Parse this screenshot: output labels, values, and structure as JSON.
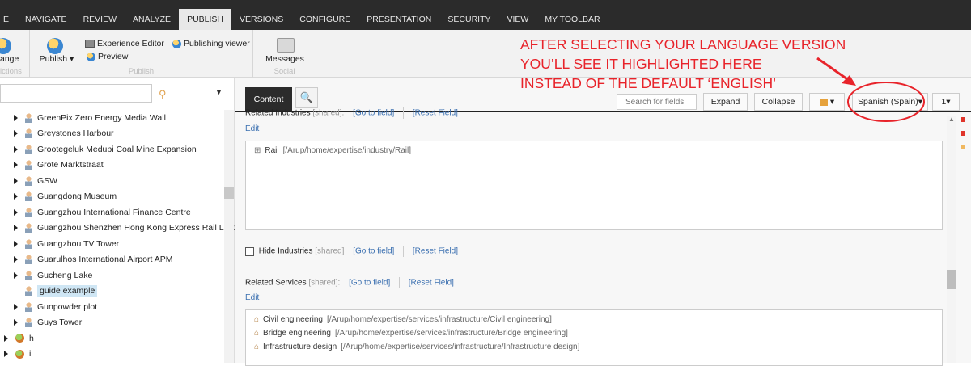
{
  "nav": {
    "tabs": [
      {
        "label": "E"
      },
      {
        "label": "NAVIGATE"
      },
      {
        "label": "REVIEW"
      },
      {
        "label": "ANALYZE"
      },
      {
        "label": "PUBLISH"
      },
      {
        "label": "VERSIONS"
      },
      {
        "label": "CONFIGURE"
      },
      {
        "label": "PRESENTATION"
      },
      {
        "label": "SECURITY"
      },
      {
        "label": "VIEW"
      },
      {
        "label": "MY TOOLBAR"
      }
    ],
    "active": "PUBLISH"
  },
  "ribbon": {
    "change_label": "ange",
    "restrictions_label": "ictions",
    "publish_label": "Publish",
    "experience_editor": "Experience Editor",
    "preview": "Preview",
    "publishing_viewer": "Publishing viewer",
    "publish_group_label": "Publish",
    "messages_label": "Messages",
    "social_group_label": "Social"
  },
  "tree": {
    "items": [
      {
        "label": "GreenPix Zero Energy Media Wall",
        "icon": "person-icon",
        "arrow": true
      },
      {
        "label": "Greystones Harbour",
        "icon": "person-icon",
        "arrow": true
      },
      {
        "label": "Grootegeluk Medupi Coal Mine Expansion",
        "icon": "person-icon",
        "arrow": true
      },
      {
        "label": "Grote Marktstraat",
        "icon": "person-icon",
        "arrow": true
      },
      {
        "label": "GSW",
        "icon": "person-icon",
        "arrow": true
      },
      {
        "label": "Guangdong Museum",
        "icon": "person-icon",
        "arrow": true
      },
      {
        "label": "Guangzhou International Finance Centre",
        "icon": "person-icon",
        "arrow": true
      },
      {
        "label": "Guangzhou Shenzhen Hong Kong Express Rail Link",
        "icon": "person-icon",
        "arrow": true
      },
      {
        "label": "Guangzhou TV Tower",
        "icon": "person-icon",
        "arrow": true
      },
      {
        "label": "Guarulhos International Airport APM",
        "icon": "person-icon",
        "arrow": true
      },
      {
        "label": "Gucheng Lake",
        "icon": "person-icon",
        "arrow": true
      },
      {
        "label": "guide example",
        "icon": "person-icon",
        "arrow": false,
        "selected": true
      },
      {
        "label": "Gunpowder plot",
        "icon": "person-icon",
        "arrow": true
      },
      {
        "label": "Guys Tower",
        "icon": "person-icon",
        "arrow": true
      },
      {
        "label": "h",
        "icon": "leaf-icon",
        "arrow": true
      },
      {
        "label": "i",
        "icon": "leaf-icon",
        "arrow": true
      }
    ]
  },
  "content": {
    "tab_label": "Content",
    "search_placeholder": "Search for fields",
    "expand": "Expand",
    "collapse": "Collapse",
    "language": "Spanish (Spain)",
    "version": "1",
    "industries": {
      "label": "Related Industries",
      "shared": "[shared]:",
      "goto": "[Go to field]",
      "reset": "[Reset Field]",
      "edit": "Edit",
      "items": [
        {
          "name": "Rail",
          "path": "[/Arup/home/expertise/industry/Rail]"
        }
      ]
    },
    "hide_industries": {
      "label": "Hide Industries",
      "shared": "[shared]",
      "goto": "[Go to field]",
      "reset": "[Reset Field]"
    },
    "services": {
      "label": "Related Services",
      "shared": "[shared]:",
      "goto": "[Go to field]",
      "reset": "[Reset Field]",
      "edit": "Edit",
      "items": [
        {
          "name": "Civil engineering",
          "path": "[/Arup/home/expertise/services/infrastructure/Civil engineering]"
        },
        {
          "name": "Bridge engineering",
          "path": "[/Arup/home/expertise/services/infrastructure/Bridge engineering]"
        },
        {
          "name": "Infrastructure design",
          "path": "[/Arup/home/expertise/services/infrastructure/Infrastructure design]"
        }
      ]
    }
  },
  "annotation": {
    "lines": [
      "AFTER SELECTING YOUR LANGUAGE VERSION",
      "YOU’LL SEE IT HIGHLIGHTED HERE",
      "INSTEAD OF THE DEFAULT ‘ENGLISH’"
    ],
    "color": "#e8232a"
  },
  "colors": {
    "topbar": "#2b2b2b",
    "accent_link": "#3a6fb0",
    "selection": "#cfe6f4"
  }
}
